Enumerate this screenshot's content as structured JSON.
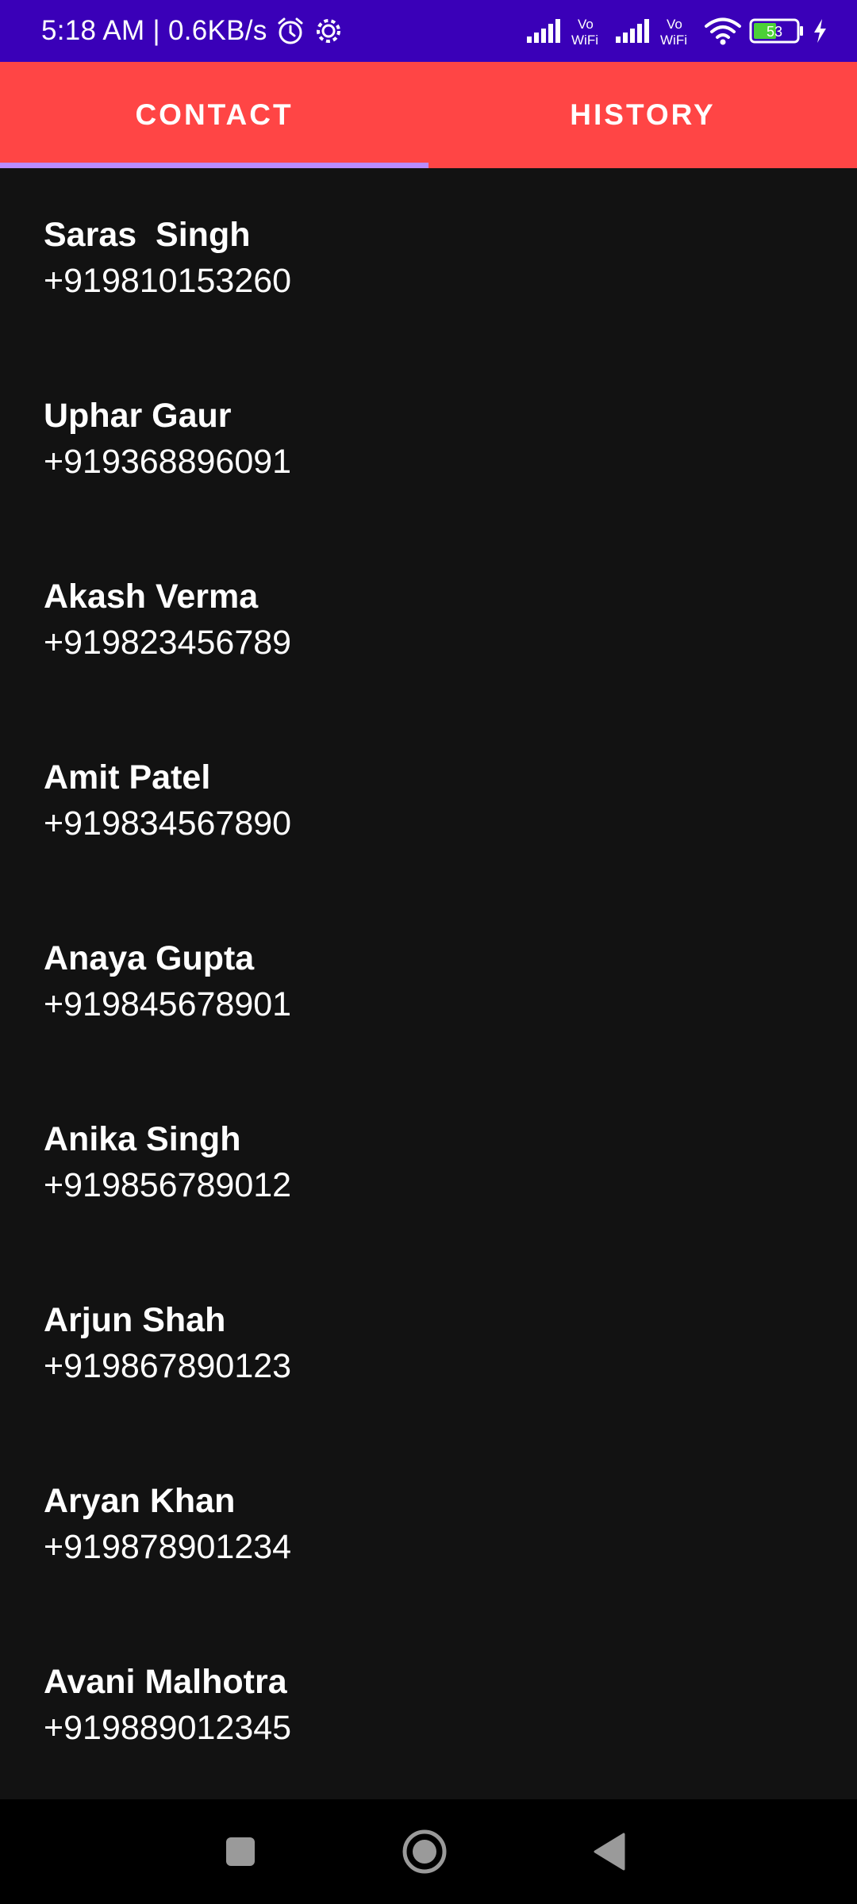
{
  "status_bar": {
    "text": "5:18 AM | 0.6KB/s",
    "icons": [
      "alarm-icon",
      "settings-icon",
      "signal-icon",
      "vowifi-icon",
      "signal-icon",
      "vowifi-icon",
      "wifi-icon",
      "battery-icon",
      "charging-icon"
    ],
    "vowifi_top": "Vo",
    "vowifi_bottom": "WiFi",
    "battery_level": "53"
  },
  "tabs": [
    {
      "label": "CONTACT",
      "active": true
    },
    {
      "label": "HISTORY",
      "active": false
    }
  ],
  "contacts": [
    {
      "name": "Saras  Singh",
      "phone": "+919810153260"
    },
    {
      "name": "Uphar Gaur",
      "phone": "+919368896091"
    },
    {
      "name": "Akash Verma",
      "phone": "+919823456789"
    },
    {
      "name": "Amit Patel",
      "phone": "+919834567890"
    },
    {
      "name": "Anaya Gupta",
      "phone": "+919845678901"
    },
    {
      "name": "Anika Singh",
      "phone": "+919856789012"
    },
    {
      "name": "Arjun Shah",
      "phone": "+919867890123"
    },
    {
      "name": "Aryan Khan",
      "phone": "+919878901234"
    },
    {
      "name": "Avani Malhotra",
      "phone": "+919889012345"
    }
  ],
  "nav_bar": {
    "buttons": [
      "recents-icon",
      "home-icon",
      "back-icon"
    ]
  },
  "colors": {
    "status_bar": "#3a00b8",
    "tab_bar": "#ff4545",
    "tab_indicator": "#b98cff",
    "background": "#121212",
    "nav_bar": "#000000"
  }
}
